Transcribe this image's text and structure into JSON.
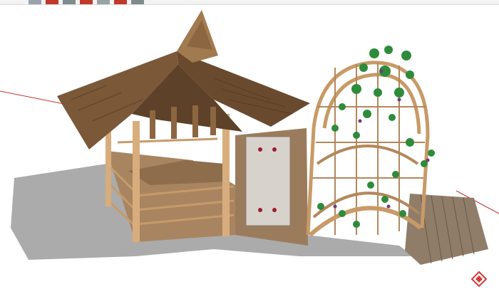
{
  "app": {
    "title": ""
  },
  "toolbar": {
    "buttons": [
      {
        "name": "toolbar-button-1",
        "color": "#9aa3ad"
      },
      {
        "name": "toolbar-button-2",
        "color": "#c0392b"
      },
      {
        "name": "toolbar-button-3",
        "color": "#7f8c8d"
      },
      {
        "name": "toolbar-button-4",
        "color": "#c0392b"
      },
      {
        "name": "toolbar-button-5",
        "color": "#95a5a6"
      },
      {
        "name": "toolbar-button-6",
        "color": "#c0392b"
      },
      {
        "name": "toolbar-button-7",
        "color": "#7f8c8d"
      }
    ]
  },
  "scene": {
    "sign_text": "",
    "colors": {
      "thatch": "#7a5838",
      "thatch_dark": "#4e3420",
      "wood": "#b98a5a",
      "wood_dark": "#7b5a3a",
      "deck": "#8f7d6a",
      "shadow": "#9c9c9c",
      "leaf": "#2e8b3a",
      "grape": "#6d3a7a",
      "panel": "#d8d2cc",
      "axis_red": "#cc3333"
    }
  },
  "watermark": {
    "icon": "logo-watermark-icon"
  }
}
